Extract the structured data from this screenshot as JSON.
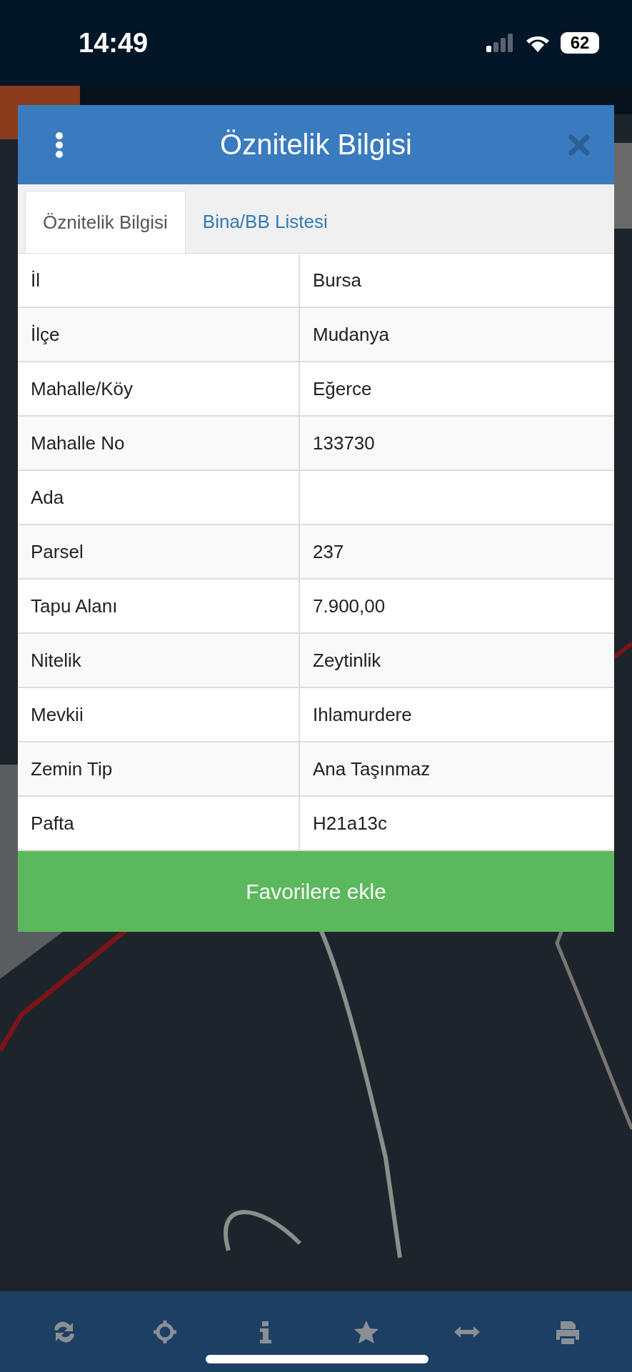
{
  "status_bar": {
    "time": "14:49",
    "battery": "62"
  },
  "dialog": {
    "title": "Öznitelik Bilgisi",
    "tabs": [
      {
        "label": "Öznitelik Bilgisi",
        "selected": true
      },
      {
        "label": "Bina/BB Listesi",
        "selected": false
      }
    ],
    "rows": [
      {
        "label": "İl",
        "value": "Bursa"
      },
      {
        "label": "İlçe",
        "value": "Mudanya"
      },
      {
        "label": "Mahalle/Köy",
        "value": "Eğerce"
      },
      {
        "label": "Mahalle No",
        "value": "133730"
      },
      {
        "label": "Ada"
      },
      {
        "label": "Parsel",
        "value": "237"
      },
      {
        "label": "Tapu Alanı",
        "value": "7.900,00"
      },
      {
        "label": "Nitelik",
        "value": "Zeytinlik"
      },
      {
        "label": "Mevkii",
        "value": "Ihlamurdere"
      },
      {
        "label": "Zemin Tip",
        "value": "Ana Taşınmaz"
      },
      {
        "label": "Pafta",
        "value": "H21a13c"
      }
    ],
    "action": "Favorilere ekle"
  },
  "toolbar": [
    {
      "kind": "refresh"
    },
    {
      "kind": "locate"
    },
    {
      "kind": "info"
    },
    {
      "kind": "star"
    },
    {
      "kind": "width"
    },
    {
      "kind": "print"
    }
  ]
}
